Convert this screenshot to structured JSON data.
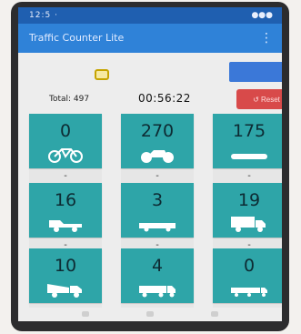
{
  "status_bar": {
    "time": "12:5 · ",
    "right_icons": "●●●"
  },
  "app_bar": {
    "title": "Traffic Counter Lite",
    "menu_label": "⋮"
  },
  "toolbar": {
    "key_icon": "key-icon",
    "reset_label": "↺ Reset"
  },
  "summary": {
    "total_label": "Total: 497",
    "elapsed": "00:56:22"
  },
  "tiles": [
    {
      "count": "0",
      "vehicle": "bicycle",
      "minus": "-"
    },
    {
      "count": "270",
      "vehicle": "motorcycle",
      "minus": "-"
    },
    {
      "count": "175",
      "vehicle": "car",
      "minus": "-"
    },
    {
      "count": "16",
      "vehicle": "pickup",
      "minus": "-"
    },
    {
      "count": "3",
      "vehicle": "bus",
      "minus": "-"
    },
    {
      "count": "19",
      "vehicle": "truck",
      "minus": "-"
    },
    {
      "count": "10",
      "vehicle": "dump-truck",
      "minus": "-"
    },
    {
      "count": "4",
      "vehicle": "trailer-truck",
      "minus": "-"
    },
    {
      "count": "0",
      "vehicle": "long-truck",
      "minus": "-"
    }
  ],
  "colors": {
    "tile": "#2ea5a8",
    "app_bar": "#2f82d8",
    "blue_button": "#3b78d8",
    "red_button": "#d84a4a"
  }
}
